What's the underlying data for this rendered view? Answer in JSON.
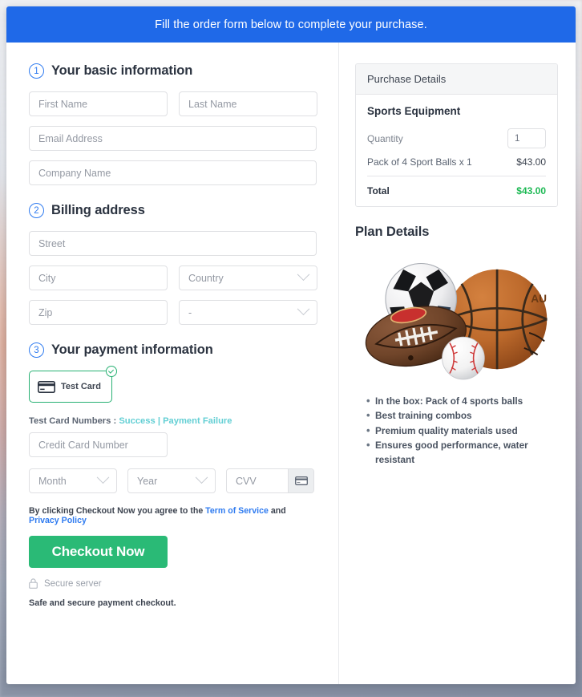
{
  "banner": {
    "message": "Fill the order form below to complete your purchase."
  },
  "steps": [
    {
      "num": "1",
      "title": "Your basic information"
    },
    {
      "num": "2",
      "title": "Billing address"
    },
    {
      "num": "3",
      "title": "Your payment information"
    }
  ],
  "basic_info": {
    "first_name_placeholder": "First Name",
    "last_name_placeholder": "Last Name",
    "email_placeholder": "Email Address",
    "company_placeholder": "Company Name"
  },
  "billing": {
    "street_placeholder": "Street",
    "city_placeholder": "City",
    "country_placeholder": "Country",
    "zip_placeholder": "Zip",
    "state_placeholder": "-"
  },
  "payment": {
    "card_tile_label": "Test  Card",
    "test_numbers_label": "Test Card Numbers :",
    "success_link": "Success",
    "separator": "|",
    "failure_link": "Payment Failure",
    "cc_placeholder": "Credit Card Number",
    "month_placeholder": "Month",
    "year_placeholder": "Year",
    "cvv_placeholder": "CVV"
  },
  "footer": {
    "terms_prefix": "By clicking Checkout Now you agree to the",
    "terms_link": "Term of Service",
    "terms_and": "and",
    "privacy_link": "Privacy Policy",
    "checkout_label": "Checkout Now",
    "secure_server": "Secure server",
    "safe_note": "Safe and secure payment checkout."
  },
  "purchase_details": {
    "header": "Purchase Details",
    "product": "Sports Equipment",
    "quantity_label": "Quantity",
    "quantity_value": "1",
    "item_label": "Pack of 4 Sport Balls x 1",
    "item_amount": "$43.00",
    "total_label": "Total",
    "total_amount": "$43.00"
  },
  "plan_details": {
    "title": "Plan Details",
    "image_alt": "sports-balls-photo",
    "features": [
      "In the box: Pack of 4 sports balls",
      "Best training combos",
      "Premium quality materials used",
      "Ensures good performance, water resistant"
    ]
  },
  "colors": {
    "banner_blue": "#1f69e8",
    "accent_blue": "#2f7bf0",
    "green": "#2aba76",
    "total_green": "#1db954",
    "link_teal": "#63cfd4"
  }
}
